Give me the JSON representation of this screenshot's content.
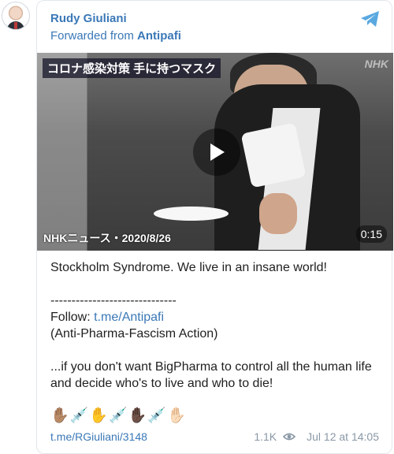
{
  "channel": {
    "sender_name": "Rudy Giuliani",
    "forwarded_prefix": "Forwarded from",
    "forwarded_from": "Antipafi"
  },
  "video": {
    "caption": "コロナ感染対策 手に持つマスク",
    "broadcaster": "NHK",
    "source_label": "NHKニュース・2020/8/26",
    "duration": "0:15"
  },
  "message": {
    "line1": "Stockholm Syndrome. We live in an insane world!",
    "divider": "------------------------------",
    "follow_prefix": "Follow: ",
    "follow_link": "t.me/Antipafi",
    "tagline": "(Anti-Pharma-Fascism Action)",
    "closing": "...if you don't want BigPharma to control all the human life and decide who's to live and who to die!",
    "emoji": "✋🏽💉✋💉✋🏿💉✋🏻"
  },
  "footer": {
    "post_link": "t.me/RGiuliani/3148",
    "views": "1.1K",
    "timestamp": "Jul 12 at 14:05"
  },
  "colors": {
    "link": "#3a78b7",
    "muted": "#8a98a6"
  }
}
